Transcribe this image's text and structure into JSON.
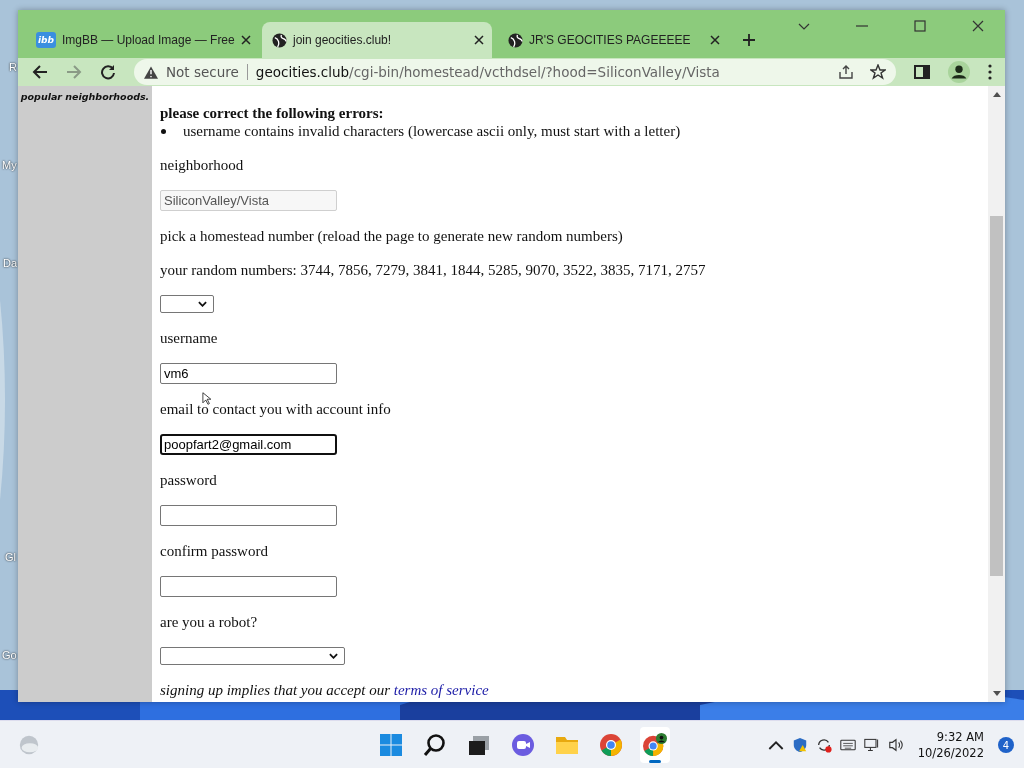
{
  "desktop_icons": [
    {
      "label": "R"
    },
    {
      "label": "My"
    },
    {
      "label": "Da"
    },
    {
      "label": "Gl"
    },
    {
      "label": "Go"
    }
  ],
  "browser": {
    "tabs": [
      {
        "title": "ImgBB — Upload Image — Free",
        "favicon": "ibb",
        "kind": "text-icon",
        "selected": false
      },
      {
        "title": "join geocities.club!",
        "kind": "globe",
        "selected": true
      },
      {
        "title": "JR'S GEOCITIES PAGEEEEE",
        "kind": "globe",
        "selected": false
      }
    ],
    "security": "Not secure",
    "url_host": "geocities.club",
    "url_path": "/cgi-bin/homestead/vcthdsel/?hood=SiliconValley/Vista"
  },
  "page": {
    "sidebar_text": "popular neighborhoods.",
    "error_heading": "please correct the following errors:",
    "errors": [
      "username contains invalid characters (lowercase ascii only, must start with a letter)"
    ],
    "items": [
      {
        "kind": "label",
        "text": "neighborhood"
      },
      {
        "kind": "input",
        "value": "SiliconValley/Vista",
        "disabled": true,
        "focused": false
      },
      {
        "kind": "label",
        "text": "pick a homestead number (reload the page to generate new random numbers)"
      },
      {
        "kind": "label",
        "text": "your random numbers: 3744, 7856, 7279, 3841, 1844, 5285, 9070, 3522, 3835, 7171, 2757"
      },
      {
        "kind": "select",
        "wide": false
      },
      {
        "kind": "label",
        "text": "username"
      },
      {
        "kind": "input",
        "value": "vm6",
        "disabled": false,
        "focused": false
      },
      {
        "kind": "label",
        "text": "email to contact you with account info"
      },
      {
        "kind": "input",
        "value": "poopfart2@gmail.com",
        "disabled": false,
        "focused": true
      },
      {
        "kind": "label",
        "text": "password"
      },
      {
        "kind": "input",
        "disabled": false,
        "focused": false
      },
      {
        "kind": "label",
        "text": "confirm password"
      },
      {
        "kind": "input",
        "disabled": false,
        "focused": false
      },
      {
        "kind": "label",
        "text": "are you a robot?"
      },
      {
        "kind": "select",
        "wide": true
      },
      {
        "kind": "terms",
        "text": "signing up implies that you accept our",
        "link": "terms of service"
      }
    ]
  },
  "taskbar": {
    "apps": [
      {
        "kind": "start",
        "active": false
      },
      {
        "kind": "search",
        "active": false
      },
      {
        "kind": "taskview",
        "active": false
      },
      {
        "kind": "chat",
        "active": false
      },
      {
        "kind": "folder",
        "active": false
      },
      {
        "kind": "chrome",
        "active": false
      },
      {
        "kind": "chrome-profile",
        "active": true
      }
    ],
    "time": "9:32 AM",
    "date": "10/26/2022",
    "notifications": "4"
  }
}
